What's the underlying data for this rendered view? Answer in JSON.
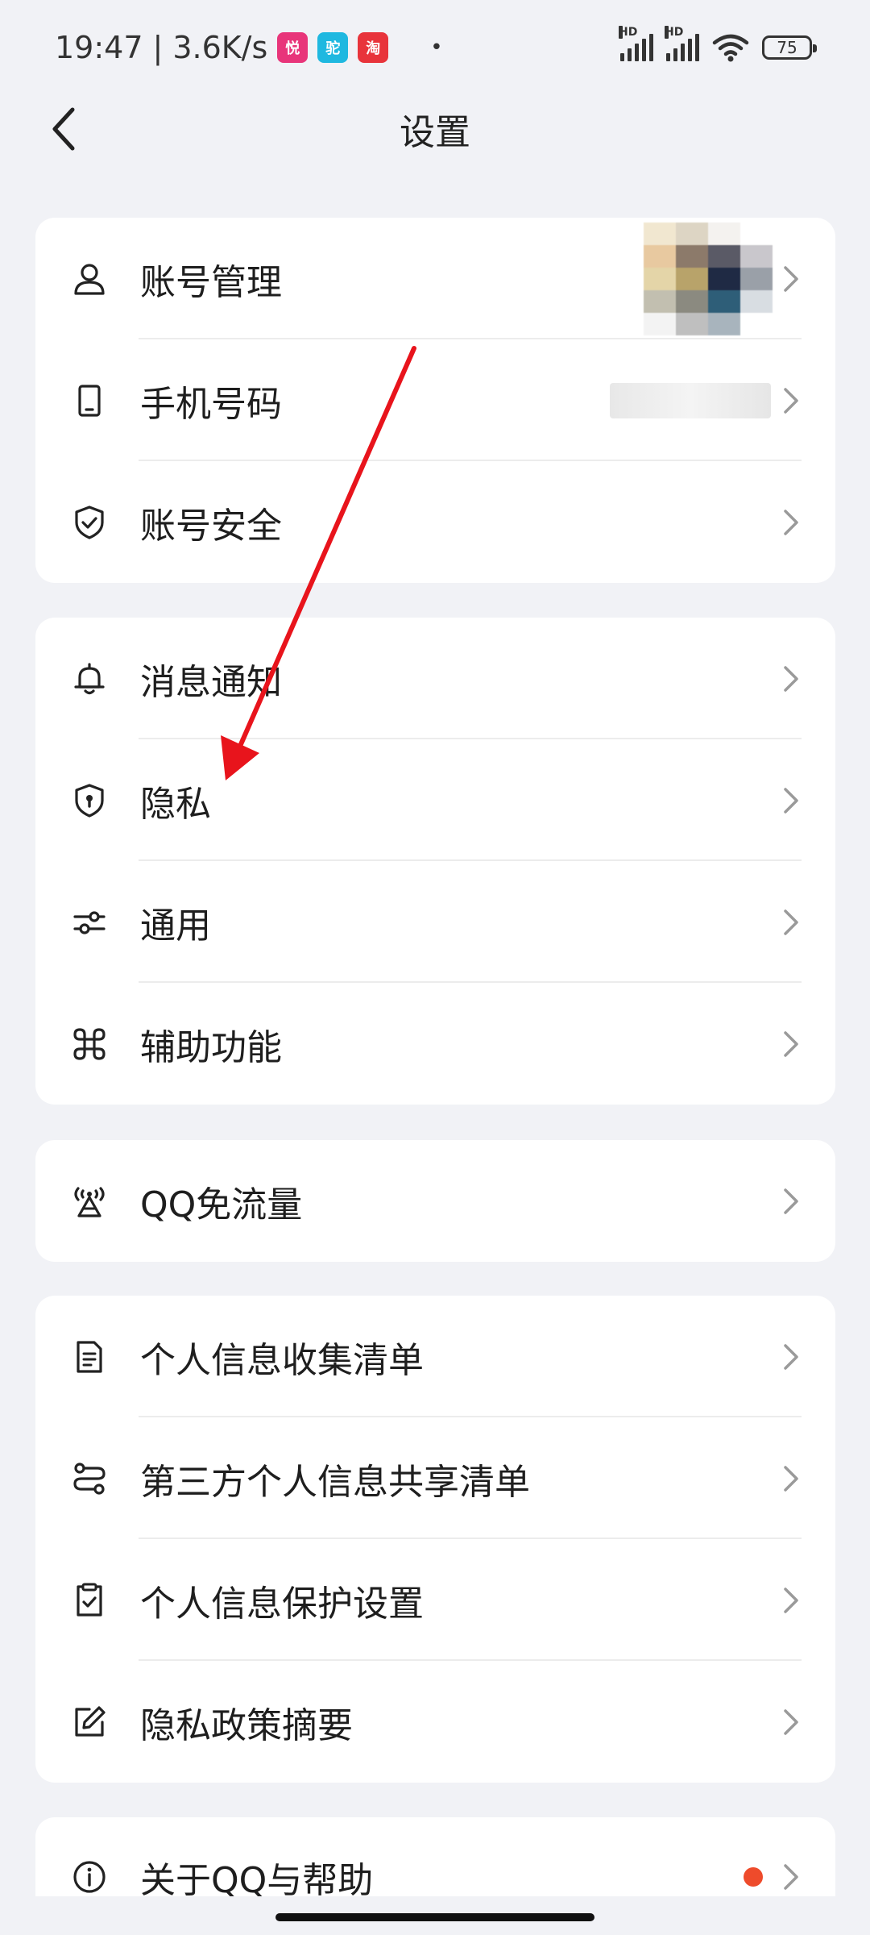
{
  "status_bar": {
    "time": "19:47",
    "speed": "3.6K/s",
    "separator": "|",
    "app_badges": [
      {
        "text": "悦",
        "color": "#e8357a"
      },
      {
        "text": "驼",
        "color": "#1fb8e0"
      },
      {
        "text": "淘",
        "color": "#e8343b"
      }
    ],
    "dot": "•",
    "hd1": "HD",
    "hd2": "HD",
    "battery": "75"
  },
  "nav": {
    "title": "设置"
  },
  "groups": [
    {
      "items": [
        {
          "label": "账号管理",
          "icon": "person-icon"
        },
        {
          "label": "手机号码",
          "icon": "phone-icon"
        },
        {
          "label": "账号安全",
          "icon": "shield-check-icon"
        }
      ]
    },
    {
      "items": [
        {
          "label": "消息通知",
          "icon": "bell-icon"
        },
        {
          "label": "隐私",
          "icon": "shield-lock-icon"
        },
        {
          "label": "通用",
          "icon": "sliders-icon"
        },
        {
          "label": "辅助功能",
          "icon": "command-icon"
        }
      ]
    },
    {
      "items": [
        {
          "label": "QQ免流量",
          "icon": "antenna-icon"
        }
      ]
    },
    {
      "items": [
        {
          "label": "个人信息收集清单",
          "icon": "document-icon"
        },
        {
          "label": "第三方个人信息共享清单",
          "icon": "share-icon"
        },
        {
          "label": "个人信息保护设置",
          "icon": "checklist-icon"
        },
        {
          "label": "隐私政策摘要",
          "icon": "edit-icon"
        }
      ]
    },
    {
      "items": [
        {
          "label": "关于QQ与帮助",
          "icon": "info-icon"
        }
      ]
    }
  ],
  "colors": {
    "background": "#f1f2f6",
    "card": "#ffffff",
    "annotation_arrow": "#e8141c",
    "notification_dot": "#ee4b2b"
  }
}
